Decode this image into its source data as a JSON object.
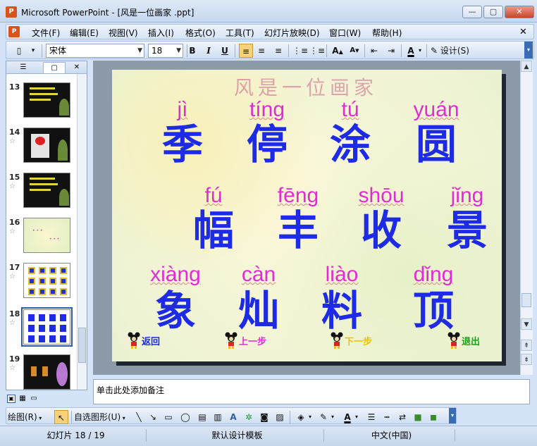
{
  "window": {
    "title": "Microsoft PowerPoint - [风是一位画家 .ppt]",
    "app_icon": "P"
  },
  "window_buttons": {
    "minimize": "—",
    "maximize": "▢",
    "close": "✕",
    "doc_close": "✕"
  },
  "menu": [
    "文件(F)",
    "编辑(E)",
    "视图(V)",
    "插入(I)",
    "格式(O)",
    "工具(T)",
    "幻灯片放映(D)",
    "窗口(W)",
    "帮助(H)"
  ],
  "toolbar": {
    "font_name": "宋体",
    "font_size": "18",
    "bold": "B",
    "italic": "I",
    "underline": "U",
    "design_label": "设计(S)",
    "font_color_label": "A"
  },
  "left_pane": {
    "tabs": [
      "outline-tab",
      "slides-tab"
    ],
    "close": "✕",
    "thumbnails": [
      {
        "num": "13",
        "star": false,
        "theme": "dark"
      },
      {
        "num": "14",
        "star": true,
        "theme": "dark-red"
      },
      {
        "num": "15",
        "star": true,
        "theme": "dark"
      },
      {
        "num": "16",
        "star": true,
        "theme": "light"
      },
      {
        "num": "17",
        "star": true,
        "theme": "grid"
      },
      {
        "num": "18",
        "star": true,
        "theme": "selected",
        "selected": true
      },
      {
        "num": "19",
        "star": true,
        "theme": "dark-flower"
      }
    ]
  },
  "slide": {
    "title": "风是一位画家",
    "rows": [
      [
        {
          "pinyin": "jì",
          "hanzi": "季"
        },
        {
          "pinyin": "tíng",
          "hanzi": "停"
        },
        {
          "pinyin": "tú",
          "hanzi": "涂"
        },
        {
          "pinyin": "yuán",
          "hanzi": "圆"
        }
      ],
      [
        {
          "pinyin": "fú",
          "hanzi": "幅"
        },
        {
          "pinyin": "fēng",
          "hanzi": "丰"
        },
        {
          "pinyin": "shōu",
          "hanzi": "收"
        },
        {
          "pinyin": "jǐng",
          "hanzi": "景"
        }
      ],
      [
        {
          "pinyin": "xiàng",
          "hanzi": "象"
        },
        {
          "pinyin": "càn",
          "hanzi": "灿"
        },
        {
          "pinyin": "liào",
          "hanzi": "料"
        },
        {
          "pinyin": "dǐng",
          "hanzi": "顶"
        }
      ]
    ],
    "nav": [
      {
        "label": "返回",
        "color": "#1d2ae6"
      },
      {
        "label": "上一步",
        "color": "#e32bd3"
      },
      {
        "label": "下一步",
        "color": "#f0c000"
      },
      {
        "label": "退出",
        "color": "#18a018"
      }
    ]
  },
  "notes": {
    "placeholder": "单击此处添加备注"
  },
  "drawing_toolbar": {
    "draw_label": "绘图(R)",
    "autoshape_label": "自选图形(U)"
  },
  "status": {
    "slide_counter": "幻灯片 18 / 19",
    "template": "默认设计模板",
    "language": "中文(中国)"
  },
  "colors": {
    "pinyin": "#e32bd3",
    "hanzi": "#1d2ae6",
    "accent": "#2d5fa8"
  }
}
